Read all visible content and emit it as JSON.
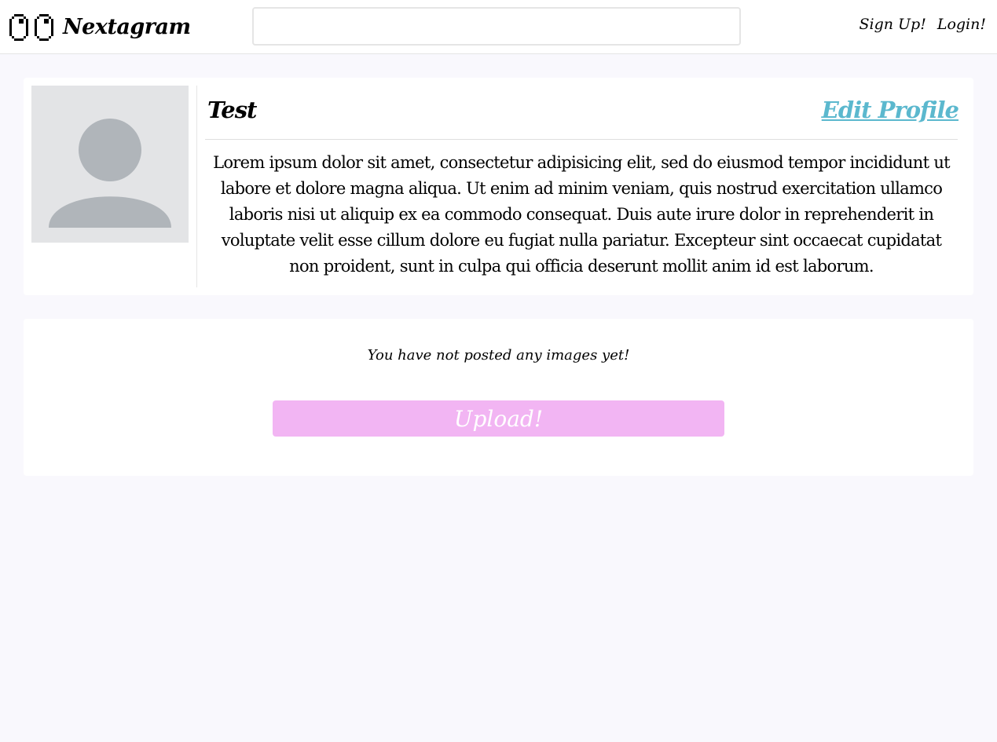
{
  "navbar": {
    "brand_name": "Nextagram",
    "brand_icon": "eyes-icon",
    "search_value": "",
    "sign_up_label": "Sign Up!",
    "login_label": "Login!"
  },
  "profile": {
    "username": "Test",
    "edit_label": "Edit Profile",
    "avatar_icon": "default-avatar-icon",
    "bio": "Lorem ipsum dolor sit amet, consectetur adipisicing elit, sed do eiusmod tempor incididunt ut labore et dolore magna aliqua. Ut enim ad minim veniam, quis nostrud exercitation ullamco laboris nisi ut aliquip ex ea commodo consequat. Duis aute irure dolor in reprehenderit in voluptate velit esse cillum dolore eu fugiat nulla pariatur. Excepteur sint occaecat cupidatat non proident, sunt in culpa qui officia deserunt mollit anim id est laborum."
  },
  "posts": {
    "empty_message": "You have not posted any images yet!",
    "upload_label": "Upload!"
  },
  "colors": {
    "background": "#f9f8fd",
    "edit_link": "#5bb8ce",
    "upload_button": "#f2b5f3",
    "avatar_bg": "#e3e4e6",
    "avatar_fg": "#b0b5ba"
  }
}
